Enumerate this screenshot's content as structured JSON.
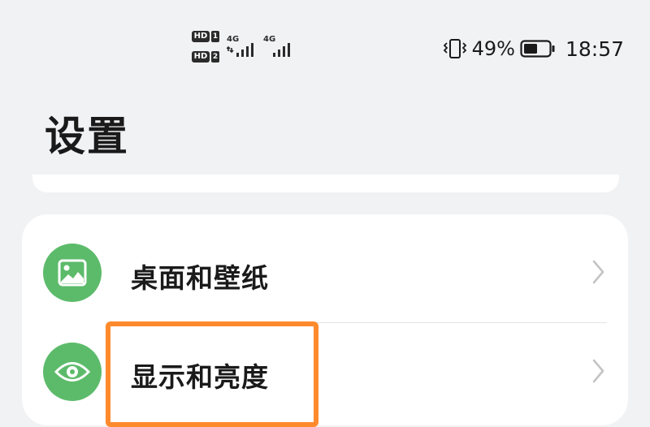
{
  "status_bar": {
    "sim1_badge": "HD",
    "sim1_slot": "1",
    "sim2_badge": "HD",
    "sim2_slot": "2",
    "sim1_network": "4G",
    "sim2_network": "4G",
    "battery_percent": "49%",
    "time": "18:57",
    "icons": [
      "vibrate-icon",
      "battery-icon",
      "signal-icon"
    ]
  },
  "page": {
    "title": "设置"
  },
  "settings": {
    "items": [
      {
        "label": "桌面和壁纸",
        "icon": "wallpaper-icon",
        "icon_color": "#5cbb6a"
      },
      {
        "label": "显示和亮度",
        "icon": "eye-icon",
        "icon_color": "#5cbb6a"
      }
    ]
  },
  "colors": {
    "background": "#f1f2f4",
    "card": "#ffffff",
    "accent_green": "#5cbb6a",
    "highlight_orange": "#ff8a2c"
  }
}
